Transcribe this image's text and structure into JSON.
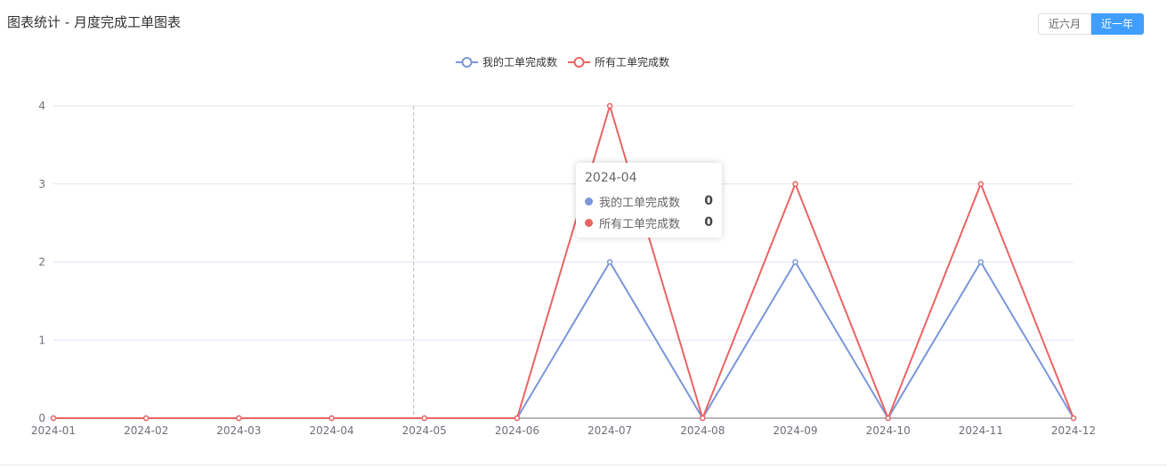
{
  "header": {
    "title": "图表统计 - 月度完成工单图表"
  },
  "range_buttons": {
    "six_months": "近六月",
    "one_year": "近一年",
    "selected": "one_year"
  },
  "tooltip": {
    "title": "2024-04",
    "rows": [
      {
        "name": "我的工单完成数",
        "value": "0",
        "color": "#7b96dc"
      },
      {
        "name": "所有工单完成数",
        "value": "0",
        "color": "#e86563"
      }
    ]
  },
  "chart_data": {
    "type": "line",
    "categories": [
      "2024-01",
      "2024-02",
      "2024-03",
      "2024-04",
      "2024-05",
      "2024-06",
      "2024-07",
      "2024-08",
      "2024-09",
      "2024-10",
      "2024-11",
      "2024-12"
    ],
    "series": [
      {
        "name": "我的工单完成数",
        "color": "#7b96dc",
        "values": [
          0,
          0,
          0,
          0,
          0,
          0,
          2,
          0,
          2,
          0,
          2,
          0
        ]
      },
      {
        "name": "所有工单完成数",
        "color": "#e86563",
        "values": [
          0,
          0,
          0,
          0,
          0,
          0,
          4,
          0,
          3,
          0,
          3,
          0
        ]
      }
    ],
    "ylim": [
      0,
      4
    ],
    "yticks": [
      0,
      1,
      2,
      3,
      4
    ],
    "legend": "top-center",
    "grid": true,
    "hover_category": "2024-04"
  }
}
